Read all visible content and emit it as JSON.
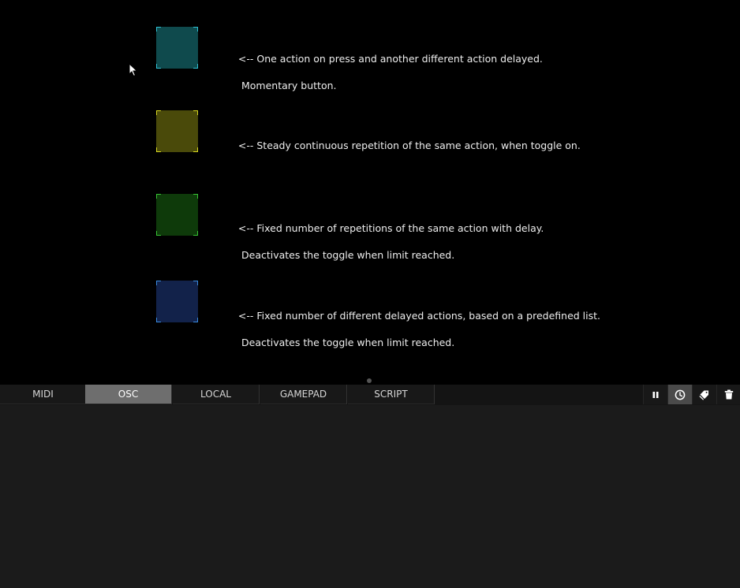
{
  "widgets": [
    {
      "color": "#0f4a4d",
      "accent": "#2fc3d6",
      "line1": "<-- One action on press and another different action delayed.",
      "line2": "Momentary button."
    },
    {
      "color": "#4a4a0a",
      "accent": "#d8d820",
      "line1": "<-- Steady continuous repetition of the same action, when toggle on.",
      "line2": ""
    },
    {
      "color": "#0e3a0a",
      "accent": "#37c334",
      "line1": "<-- Fixed number of repetitions of the same action with delay.",
      "line2": "Deactivates the toggle when limit reached."
    },
    {
      "color": "#12224a",
      "accent": "#3a8ae0",
      "line1": "<-- Fixed number of different delayed actions, based on a predefined list.",
      "line2": "Deactivates the toggle when limit reached."
    }
  ],
  "console": {
    "tabs": [
      "MIDI",
      "OSC",
      "LOCAL",
      "GAMEPAD",
      "SCRIPT"
    ],
    "active_tab": "OSC",
    "tools": [
      {
        "icon": "pause-icon",
        "active": false
      },
      {
        "icon": "clock-icon",
        "active": true
      },
      {
        "icon": "tag-icon",
        "active": false
      },
      {
        "icon": "trash-icon",
        "active": false
      }
    ]
  }
}
